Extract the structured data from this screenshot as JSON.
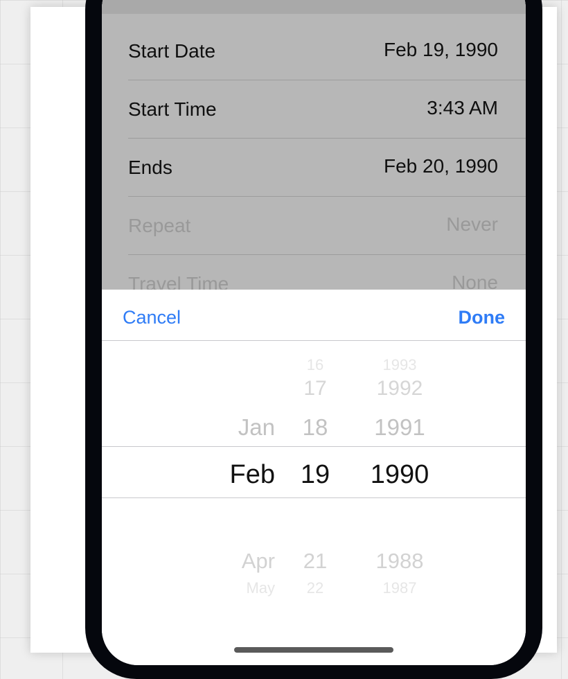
{
  "event_form": {
    "rows": [
      {
        "label": "Start Date",
        "value": "Feb 19, 1990"
      },
      {
        "label": "Start Time",
        "value": "3:43 AM"
      },
      {
        "label": "Ends",
        "value": "Feb 20, 1990"
      },
      {
        "label": "Repeat",
        "value": "Never"
      },
      {
        "label": "Travel Time",
        "value": "None"
      }
    ]
  },
  "picker": {
    "cancel_label": "Cancel",
    "done_label": "Done",
    "months": [
      "Jan",
      "Feb",
      "Apr",
      "May"
    ],
    "days": [
      "16",
      "17",
      "18",
      "19",
      "21",
      "22"
    ],
    "years": [
      "1993",
      "1992",
      "1991",
      "1990",
      "1988",
      "1987"
    ],
    "selected": {
      "month": "Feb",
      "day": "19",
      "year": "1990"
    }
  },
  "colors": {
    "accent": "#2f7cf6",
    "dimmed_overlay": "#b7b7b7",
    "phone_frame": "#05070d"
  }
}
